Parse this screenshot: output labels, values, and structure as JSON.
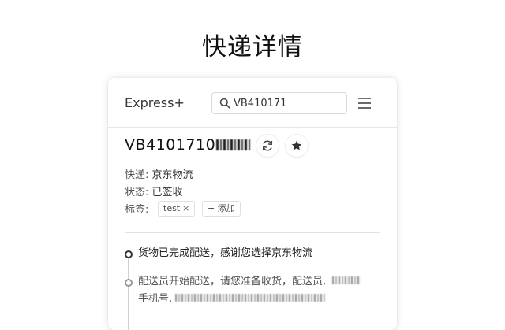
{
  "page": {
    "title": "快递详情"
  },
  "header": {
    "brand": "Express+",
    "search": {
      "value": "VB410171",
      "icon": "search-icon"
    },
    "menu_icon": "hamburger-menu-icon"
  },
  "detail": {
    "tracking_number": "VB4101710",
    "courier_label": "快递:",
    "courier_value": "京东物流",
    "status_label": "状态:",
    "status_value": "已签收",
    "tags_label": "标签:",
    "tags": [
      {
        "text": "test",
        "close": "×"
      }
    ],
    "add_tag_label": "+ 添加"
  },
  "timeline": [
    {
      "text": "货物已完成配送，感谢您选择京东物流"
    },
    {
      "line1": "配送员开始配送，请您准备收货，配送员,",
      "line2": "手机号,"
    }
  ]
}
